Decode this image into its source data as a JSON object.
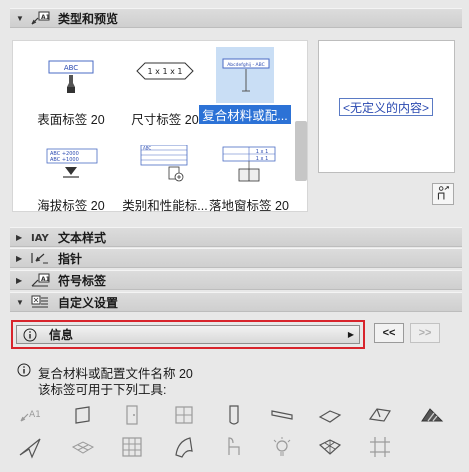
{
  "sections": {
    "type_preview": "类型和预览",
    "text_style": "文本样式",
    "pointer": "指针",
    "symbol_label": "符号标签",
    "custom_settings": "自定义设置"
  },
  "label_types": [
    {
      "label": "表面标签 20",
      "thumb_text": "ABC"
    },
    {
      "label": "尺寸标签 20",
      "thumb_text": "1 x 1 x 1"
    },
    {
      "label": "复合材料或配...",
      "thumb_text": "Abcdefghij - ABC",
      "selected": true
    },
    {
      "label": "海拔标签 20",
      "thumb_text_1": "ABC   +2000",
      "thumb_text_2": "ABC   +1000"
    },
    {
      "label": "类别和性能标...",
      "thumb_text": "ABC"
    },
    {
      "label": "落地窗标签 20",
      "thumb_text": "1 x 1"
    }
  ],
  "preview": {
    "placeholder": "<无定义的内容>"
  },
  "info_panel": {
    "title": "信息",
    "prev_label": "<<",
    "next_label": ">>"
  },
  "info_text": {
    "line1": "复合材料或配置文件名称 20",
    "line2": "该标签可用于下列工具:"
  },
  "tools": [
    "label-tool-icon",
    "wall-tool-icon",
    "door-tool-icon",
    "window-tool-icon",
    "column-tool-icon",
    "beam-tool-icon",
    "slab-tool-icon",
    "roof-tool-icon",
    "stair-tool-icon",
    "shell-tool-icon",
    "mesh-tool-icon",
    "curtain-wall-tool-icon",
    "morph-tool-icon",
    "object-tool-icon",
    "lamp-tool-icon",
    "surface-tool-icon",
    "grid-tool-icon"
  ]
}
